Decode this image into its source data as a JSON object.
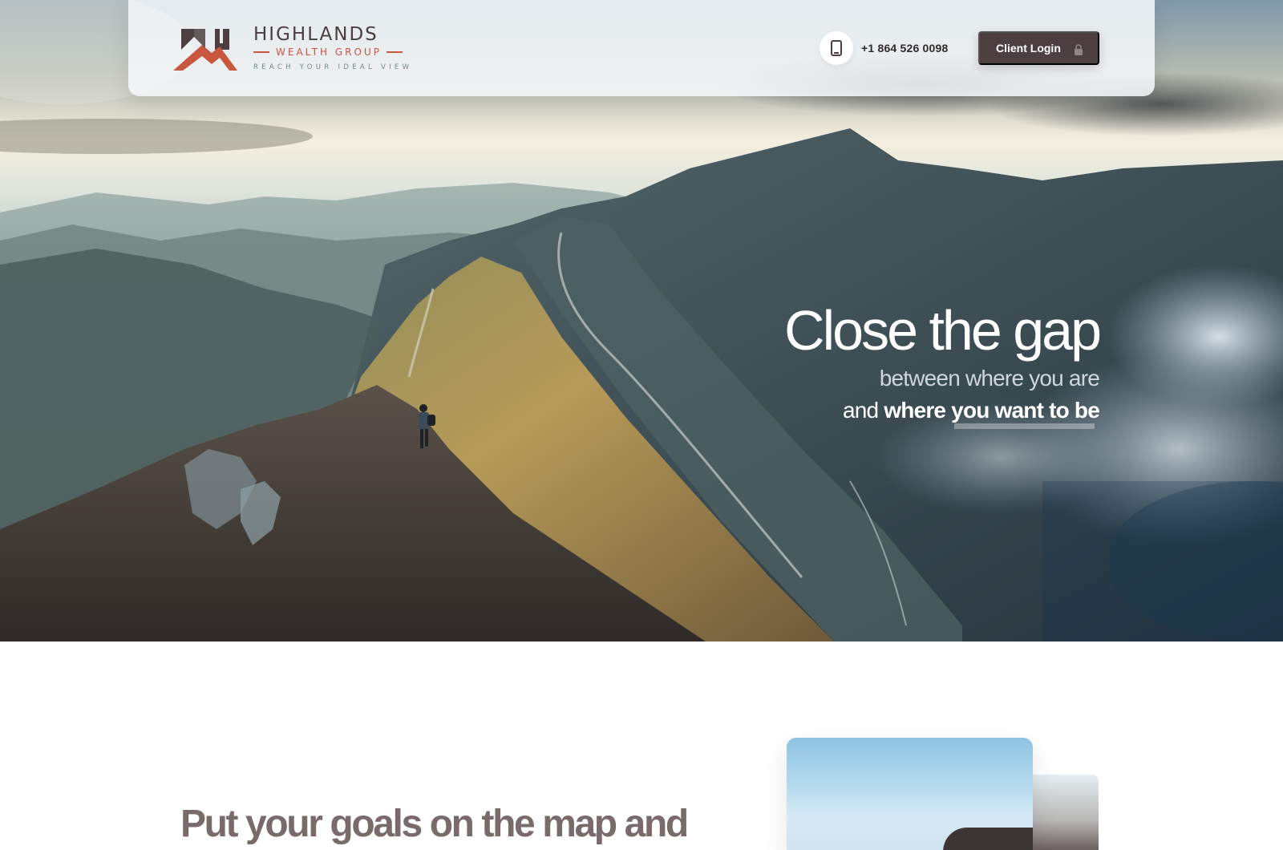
{
  "header": {
    "brand_name": "HIGHLANDS",
    "brand_sub": "WEALTH GROUP",
    "brand_tagline": "REACH YOUR IDEAL VIEW",
    "phone": "+1 864 526 0098",
    "login_label": "Client Login",
    "phone_icon": "mobile-phone-icon",
    "lock_icon": "lock-icon"
  },
  "hero": {
    "title": "Close the gap",
    "line2": "between where you are",
    "line3_prefix": "and",
    "line3_emphasis": "where you want to be"
  },
  "section": {
    "title": "Put your goals on the map and"
  },
  "colors": {
    "brand_accent": "#c9573f",
    "brand_dark": "#4d3f3f",
    "section_title": "#7a6b6b"
  }
}
